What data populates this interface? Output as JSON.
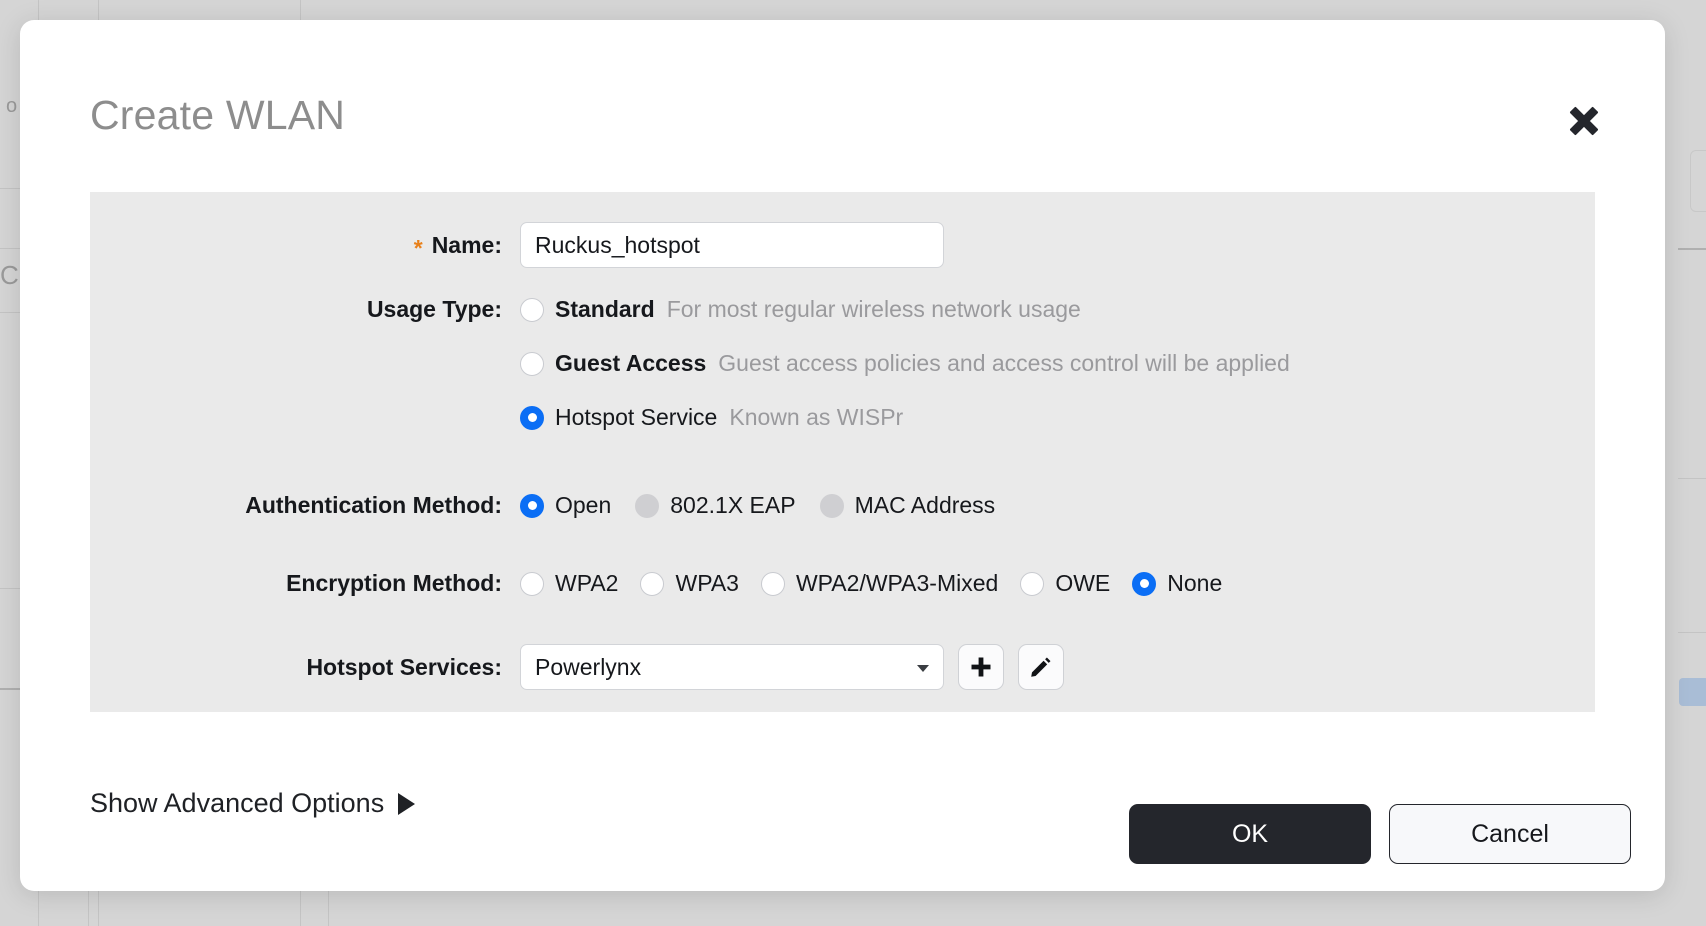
{
  "dialog": {
    "title": "Create WLAN",
    "close_icon": "close-icon"
  },
  "form": {
    "name": {
      "label": "Name:",
      "required_marker": "*",
      "value": "Ruckus_hotspot",
      "placeholder": ""
    },
    "usage_type": {
      "label": "Usage Type:",
      "options": [
        {
          "label": "Standard",
          "description": "For most regular wireless network usage",
          "selected": false,
          "disabled": false
        },
        {
          "label": "Guest Access",
          "description": "Guest access policies and access control will be applied",
          "selected": false,
          "disabled": false
        },
        {
          "label": "Hotspot Service",
          "description": "Known as WISPr",
          "selected": true,
          "disabled": false
        }
      ]
    },
    "authentication_method": {
      "label": "Authentication Method:",
      "options": [
        {
          "label": "Open",
          "selected": true,
          "disabled": false
        },
        {
          "label": "802.1X EAP",
          "selected": false,
          "disabled": true
        },
        {
          "label": "MAC Address",
          "selected": false,
          "disabled": true
        }
      ]
    },
    "encryption_method": {
      "label": "Encryption Method:",
      "options": [
        {
          "label": "WPA2",
          "selected": false,
          "disabled": false
        },
        {
          "label": "WPA3",
          "selected": false,
          "disabled": false
        },
        {
          "label": "WPA2/WPA3-Mixed",
          "selected": false,
          "disabled": false
        },
        {
          "label": "OWE",
          "selected": false,
          "disabled": false
        },
        {
          "label": "None",
          "selected": true,
          "disabled": false
        }
      ]
    },
    "hotspot_services": {
      "label": "Hotspot Services:",
      "value": "Powerlynx",
      "options": [
        "Powerlynx"
      ],
      "add_icon": "plus-icon",
      "edit_icon": "pencil-icon"
    }
  },
  "footer": {
    "advanced_label": "Show Advanced Options",
    "advanced_caret_icon": "triangle-right-icon",
    "ok_label": "OK",
    "cancel_label": "Cancel"
  },
  "colors": {
    "accent_blue": "#0b6ef5",
    "required_orange": "#e8801a",
    "panel_gray": "#eaeaea",
    "primary_button": "#24262c",
    "backdrop": "#d5d5d5"
  }
}
